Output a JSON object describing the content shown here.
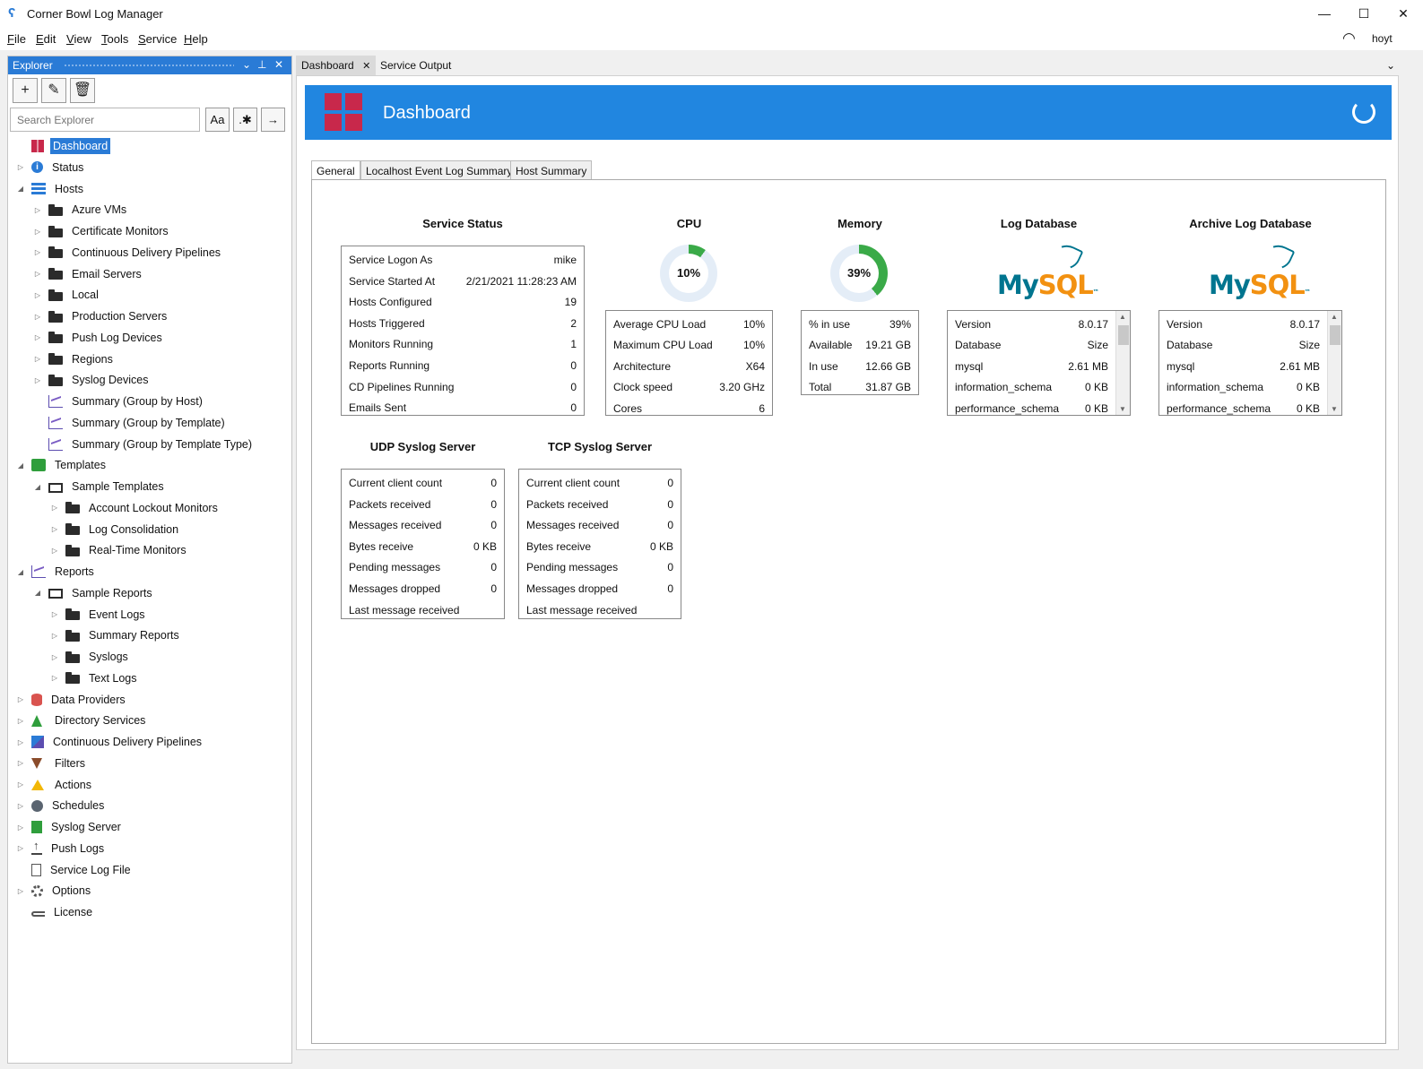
{
  "window": {
    "title": "Corner Bowl Log Manager",
    "icon": "app-logo-icon",
    "controls": [
      "—",
      "☐",
      "✕"
    ]
  },
  "menu": {
    "items": [
      {
        "pre": "",
        "u": "F",
        "post": "ile"
      },
      {
        "pre": "",
        "u": "E",
        "post": "dit"
      },
      {
        "pre": "",
        "u": "V",
        "post": "iew"
      },
      {
        "pre": "",
        "u": "T",
        "post": "ools"
      },
      {
        "pre": "",
        "u": "S",
        "post": "ervice"
      },
      {
        "pre": "",
        "u": "H",
        "post": "elp"
      }
    ],
    "user": "hoyt"
  },
  "explorer": {
    "title": "Explorer",
    "header_buttons": [
      "⌄",
      "⊥",
      "✕"
    ],
    "toolbar": [
      "+",
      "✎",
      "🗑"
    ],
    "search_placeholder": "Search Explorer",
    "search_buttons": [
      "Aa",
      ".✱",
      "→"
    ],
    "tree": [
      {
        "label": "Dashboard",
        "icon": "dash",
        "level": 1,
        "exp": "",
        "selected": true
      },
      {
        "label": "Status",
        "icon": "info",
        "level": 1,
        "exp": "▷"
      },
      {
        "label": "Hosts",
        "icon": "hosts",
        "level": 1,
        "exp": "◢"
      },
      {
        "label": "Azure VMs",
        "icon": "folder",
        "level": 2,
        "exp": "▷"
      },
      {
        "label": "Certificate Monitors",
        "icon": "folder",
        "level": 2,
        "exp": "▷"
      },
      {
        "label": "Continuous Delivery Pipelines",
        "icon": "folder",
        "level": 2,
        "exp": "▷"
      },
      {
        "label": "Email Servers",
        "icon": "folder",
        "level": 2,
        "exp": "▷"
      },
      {
        "label": "Local",
        "icon": "folder",
        "level": 2,
        "exp": "▷"
      },
      {
        "label": "Production Servers",
        "icon": "folder",
        "level": 2,
        "exp": "▷"
      },
      {
        "label": "Push Log Devices",
        "icon": "folder",
        "level": 2,
        "exp": "▷"
      },
      {
        "label": "Regions",
        "icon": "folder",
        "level": 2,
        "exp": "▷"
      },
      {
        "label": "Syslog Devices",
        "icon": "folder",
        "level": 2,
        "exp": "▷"
      },
      {
        "label": "Summary (Group by Host)",
        "icon": "chart",
        "level": 2,
        "exp": ""
      },
      {
        "label": "Summary (Group by Template)",
        "icon": "chart",
        "level": 2,
        "exp": ""
      },
      {
        "label": "Summary (Group by Template Type)",
        "icon": "chart",
        "level": 2,
        "exp": ""
      },
      {
        "label": "Templates",
        "icon": "templates",
        "level": 1,
        "exp": "◢"
      },
      {
        "label": "Sample Templates",
        "icon": "folder-open",
        "level": 2,
        "exp": "◢"
      },
      {
        "label": "Account Lockout Monitors",
        "icon": "folder",
        "level": 3,
        "exp": "▷"
      },
      {
        "label": "Log Consolidation",
        "icon": "folder",
        "level": 3,
        "exp": "▷"
      },
      {
        "label": "Real-Time Monitors",
        "icon": "folder",
        "level": 3,
        "exp": "▷"
      },
      {
        "label": "Reports",
        "icon": "chart",
        "level": 1,
        "exp": "◢"
      },
      {
        "label": "Sample Reports",
        "icon": "folder-open",
        "level": 2,
        "exp": "◢"
      },
      {
        "label": "Event Logs",
        "icon": "folder",
        "level": 3,
        "exp": "▷"
      },
      {
        "label": "Summary Reports",
        "icon": "folder",
        "level": 3,
        "exp": "▷"
      },
      {
        "label": "Syslogs",
        "icon": "folder",
        "level": 3,
        "exp": "▷"
      },
      {
        "label": "Text Logs",
        "icon": "folder",
        "level": 3,
        "exp": "▷"
      },
      {
        "label": "Data Providers",
        "icon": "db",
        "level": 1,
        "exp": "▷"
      },
      {
        "label": "Directory Services",
        "icon": "tree",
        "level": 1,
        "exp": "▷"
      },
      {
        "label": "Continuous Delivery Pipelines",
        "icon": "cd",
        "level": 1,
        "exp": "▷"
      },
      {
        "label": "Filters",
        "icon": "filter",
        "level": 1,
        "exp": "▷"
      },
      {
        "label": "Actions",
        "icon": "warn",
        "level": 1,
        "exp": "▷"
      },
      {
        "label": "Schedules",
        "icon": "clock",
        "level": 1,
        "exp": "▷"
      },
      {
        "label": "Syslog Server",
        "icon": "syslog",
        "level": 1,
        "exp": "▷"
      },
      {
        "label": "Push Logs",
        "icon": "push",
        "level": 1,
        "exp": "▷"
      },
      {
        "label": "Service Log File",
        "icon": "file",
        "level": 1,
        "exp": ""
      },
      {
        "label": "Options",
        "icon": "gear",
        "level": 1,
        "exp": "▷"
      },
      {
        "label": "License",
        "icon": "key",
        "level": 1,
        "exp": ""
      }
    ]
  },
  "doc_tabs": {
    "dashboard": "Dashboard",
    "close": "✕",
    "service_output": "Service Output",
    "overflow": "⌄"
  },
  "dashboard": {
    "title": "Dashboard",
    "colors": {
      "banner": "#2186e0",
      "logo": "#c8284b",
      "gauge": "#3aaa48",
      "gauge_track": "#e4edf7"
    },
    "sub_tabs": [
      "General",
      "Localhost Event Log Summary",
      "Host Summary"
    ],
    "service_status": {
      "title": "Service Status",
      "rows": [
        {
          "k": "Service Logon As",
          "v": "mike"
        },
        {
          "k": "Service Started At",
          "v": "2/21/2021 11:28:23 AM"
        },
        {
          "k": "Hosts Configured",
          "v": "19"
        },
        {
          "k": "Hosts Triggered",
          "v": "2"
        },
        {
          "k": "Monitors Running",
          "v": "1"
        },
        {
          "k": "Reports Running",
          "v": "0"
        },
        {
          "k": "CD Pipelines Running",
          "v": "0"
        },
        {
          "k": "Emails Sent",
          "v": "0"
        }
      ]
    },
    "cpu": {
      "title": "CPU",
      "percent": 10,
      "label": "10%",
      "rows": [
        {
          "k": "Average CPU Load",
          "v": "10%"
        },
        {
          "k": "Maximum CPU Load",
          "v": "10%"
        },
        {
          "k": "Architecture",
          "v": "X64"
        },
        {
          "k": "Clock speed",
          "v": "3.20 GHz"
        },
        {
          "k": "Cores",
          "v": "6"
        }
      ]
    },
    "memory": {
      "title": "Memory",
      "percent": 39,
      "label": "39%",
      "rows": [
        {
          "k": "% in use",
          "v": "39%"
        },
        {
          "k": "Available",
          "v": "19.21 GB"
        },
        {
          "k": "In use",
          "v": "12.66 GB"
        },
        {
          "k": "Total",
          "v": "31.87 GB"
        }
      ]
    },
    "log_db": {
      "title": "Log Database",
      "logo_my": "My",
      "logo_sql": "SQL",
      "tm": "™",
      "rows": [
        {
          "k": "Version",
          "v": "8.0.17"
        },
        {
          "k": "Database",
          "v": "Size"
        },
        {
          "k": "mysql",
          "v": "2.61 MB"
        },
        {
          "k": "information_schema",
          "v": "0 KB"
        },
        {
          "k": "performance_schema",
          "v": "0 KB"
        }
      ]
    },
    "archive_db": {
      "title": "Archive Log Database",
      "logo_my": "My",
      "logo_sql": "SQL",
      "tm": "™",
      "rows": [
        {
          "k": "Version",
          "v": "8.0.17"
        },
        {
          "k": "Database",
          "v": "Size"
        },
        {
          "k": "mysql",
          "v": "2.61 MB"
        },
        {
          "k": "information_schema",
          "v": "0 KB"
        },
        {
          "k": "performance_schema",
          "v": "0 KB"
        }
      ]
    },
    "udp": {
      "title": "UDP Syslog Server",
      "rows": [
        {
          "k": "Current client count",
          "v": "0"
        },
        {
          "k": "Packets received",
          "v": "0"
        },
        {
          "k": "Messages received",
          "v": "0"
        },
        {
          "k": "Bytes receive",
          "v": "0 KB"
        },
        {
          "k": "Pending messages",
          "v": "0"
        },
        {
          "k": "Messages dropped",
          "v": "0"
        },
        {
          "k": "Last message received",
          "v": ""
        }
      ]
    },
    "tcp": {
      "title": "TCP Syslog Server",
      "rows": [
        {
          "k": "Current client count",
          "v": "0"
        },
        {
          "k": "Packets received",
          "v": "0"
        },
        {
          "k": "Messages received",
          "v": "0"
        },
        {
          "k": "Bytes receive",
          "v": "0 KB"
        },
        {
          "k": "Pending messages",
          "v": "0"
        },
        {
          "k": "Messages dropped",
          "v": "0"
        },
        {
          "k": "Last message received",
          "v": ""
        }
      ]
    }
  }
}
